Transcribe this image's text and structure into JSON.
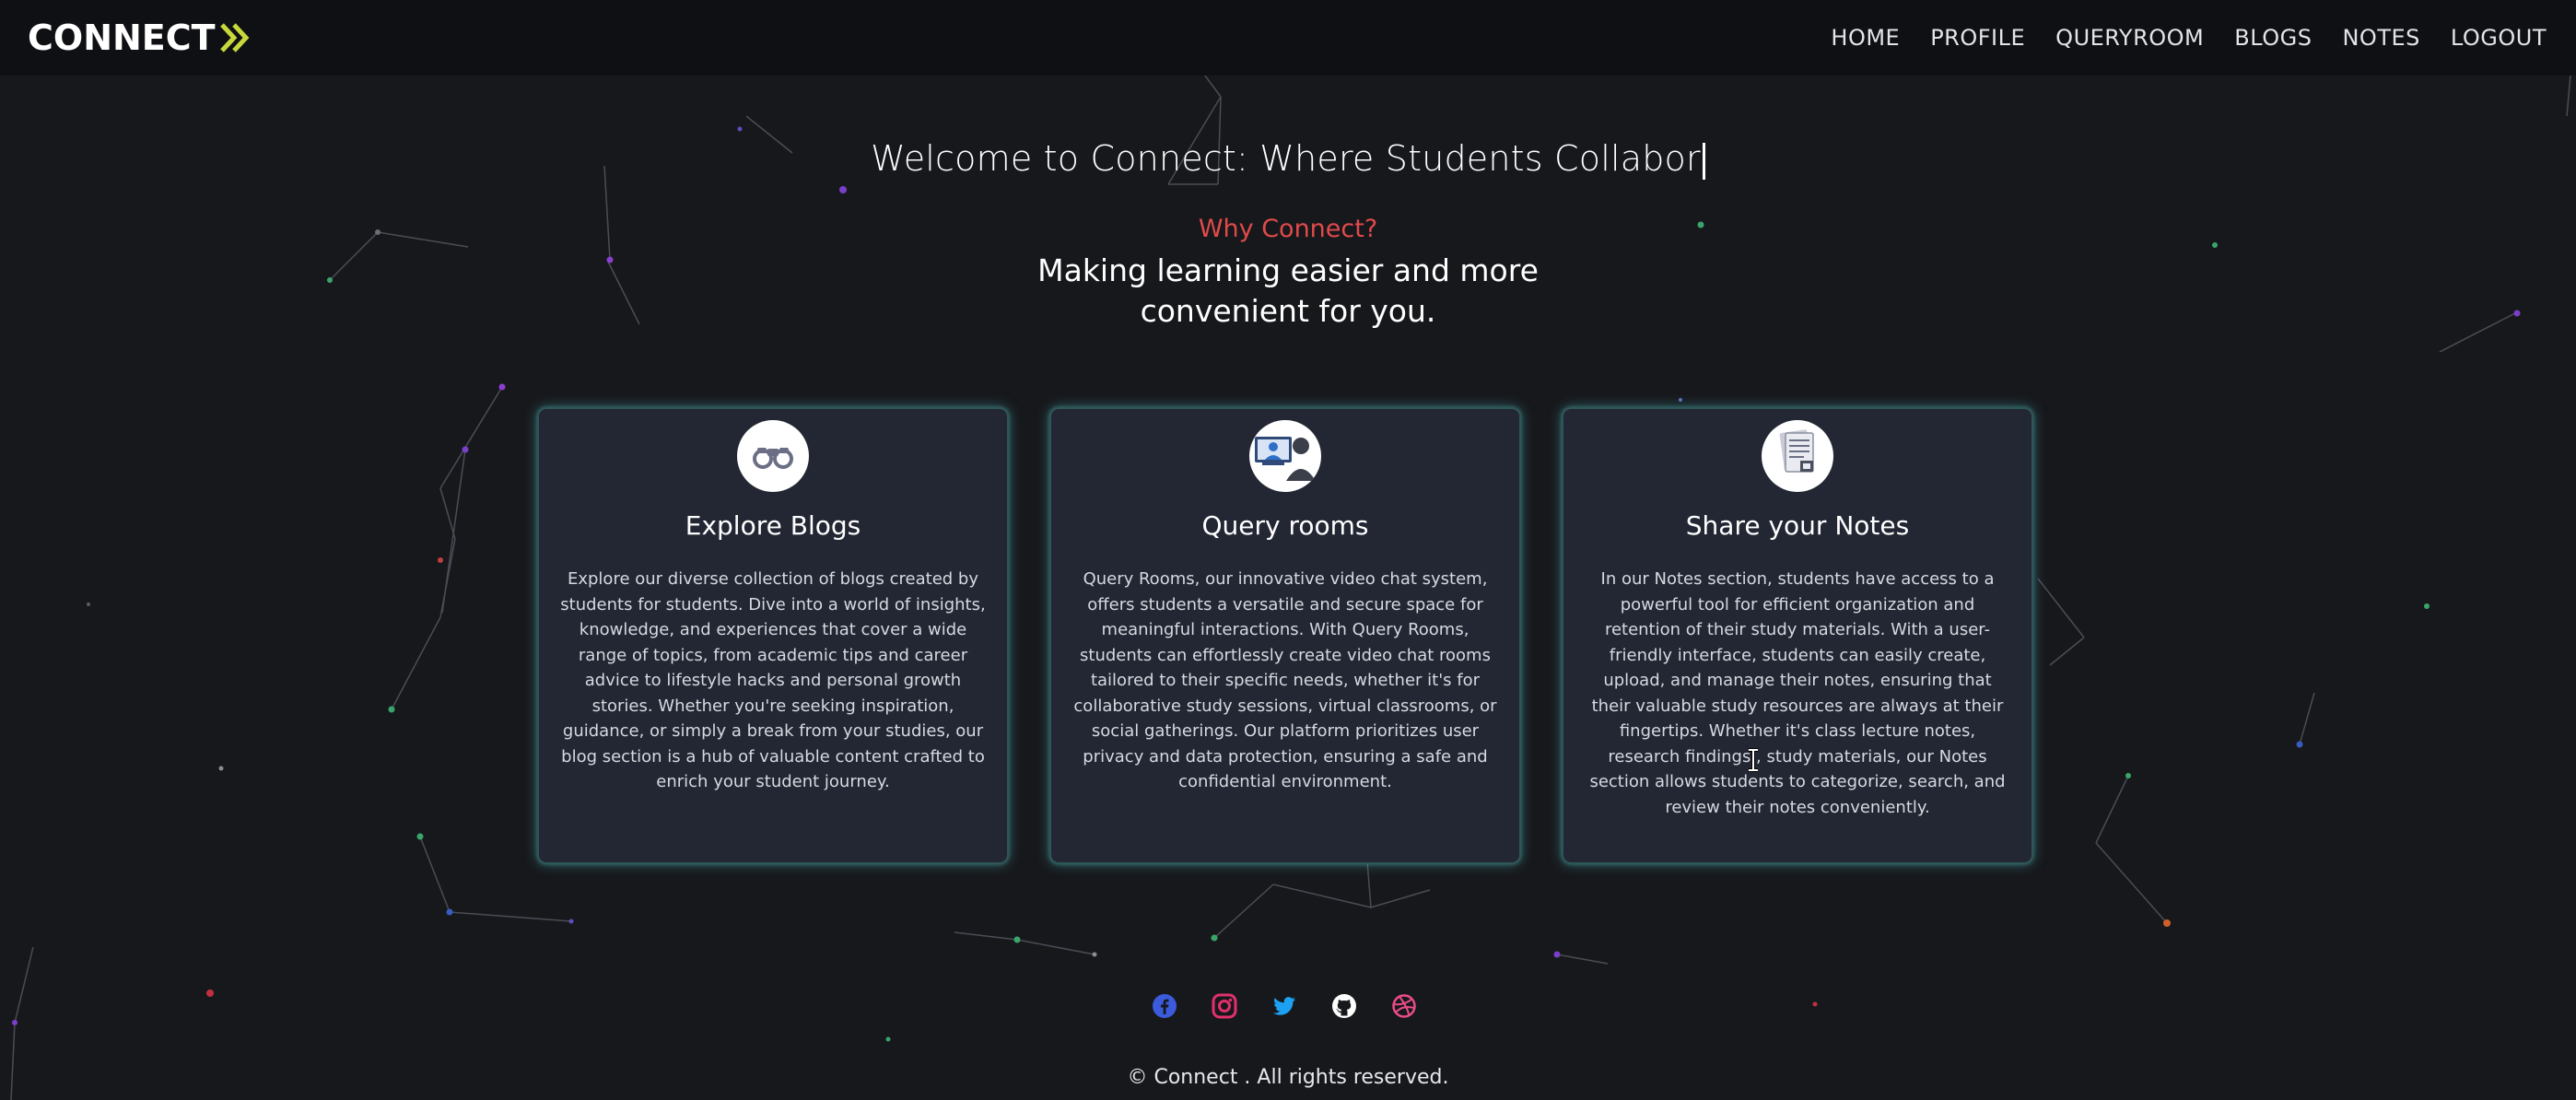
{
  "brand": {
    "name": "CONNECT",
    "accent": "#c8d83a"
  },
  "nav": {
    "items": [
      {
        "label": "HOME"
      },
      {
        "label": "PROFILE"
      },
      {
        "label": "QUERYROOM"
      },
      {
        "label": "BLOGS"
      },
      {
        "label": "NOTES"
      },
      {
        "label": "LOGOUT"
      }
    ]
  },
  "hero": {
    "title": "Welcome to Connect: Where Students Collabor",
    "why_label": "Why Connect?",
    "tagline": "Making learning easier and more convenient for you."
  },
  "cards": [
    {
      "icon": "binoculars-icon",
      "title": "Explore Blogs",
      "body": "Explore our diverse collection of blogs created by students for students. Dive into a world of insights, knowledge, and experiences that cover a wide range of topics, from academic tips and career advice to lifestyle hacks and personal growth stories. Whether you're seeking inspiration, guidance, or simply a break from your studies, our blog section is a hub of valuable content crafted to enrich your student journey."
    },
    {
      "icon": "video-chat-icon",
      "title": "Query rooms",
      "body": "Query Rooms, our innovative video chat system, offers students a versatile and secure space for meaningful interactions. With Query Rooms, students can effortlessly create video chat rooms tailored to their specific needs, whether it's for collaborative study sessions, virtual classrooms, or social gatherings. Our platform prioritizes user privacy and data protection, ensuring a safe and confidential environment."
    },
    {
      "icon": "notes-document-icon",
      "title": "Share your Notes",
      "body": "In our Notes section, students have access to a powerful tool for efficient organization and retention of their study materials. With a user-friendly interface, students can easily create, upload, and manage their notes, ensuring that their valuable study resources are always at their fingertips. Whether it's class lecture notes, research findings , study materials, our Notes section allows students to categorize, search, and review their notes conveniently."
    }
  ],
  "socials": [
    {
      "icon": "facebook-icon",
      "color": "#3b5bdb"
    },
    {
      "icon": "instagram-icon",
      "color": "#e1306c"
    },
    {
      "icon": "twitter-icon",
      "color": "#1da1f2"
    },
    {
      "icon": "github-icon",
      "color": "#ffffff"
    },
    {
      "icon": "dribbble-icon",
      "color": "#ea4c89"
    }
  ],
  "footer": {
    "copyright": "© Connect . All rights reserved."
  },
  "colors": {
    "background": "#17181c",
    "navbar": "#0f1014",
    "card": "#222733",
    "card_glow": "#46aaaa",
    "why_label": "#e04a4a"
  }
}
